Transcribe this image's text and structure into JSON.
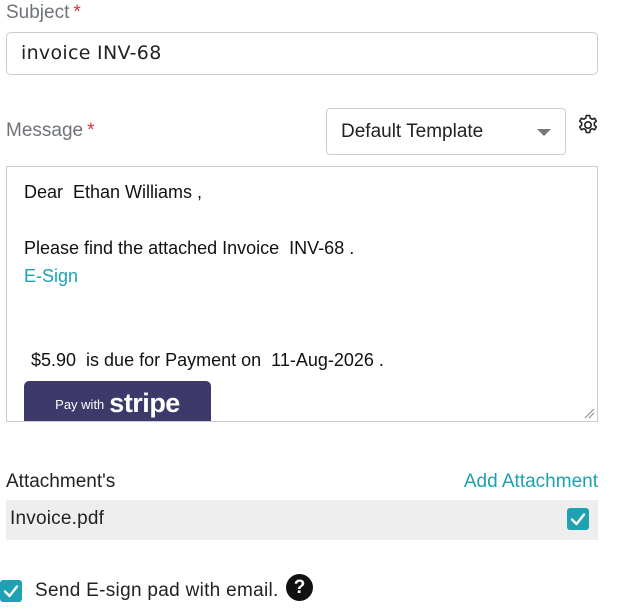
{
  "form": {
    "subject_label": "Subject",
    "required_mark": "*",
    "subject_value": "invoice INV-68",
    "message_label": "Message",
    "template_selected": "Default Template"
  },
  "editor": {
    "line1": "Dear  Ethan Williams ,",
    "line2": "Please find the attached Invoice  INV-68 .",
    "esign_link": "E-Sign",
    "line3": " $5.90  is due for Payment on  11-Aug-2026 .",
    "stripe_small": "Pay with",
    "stripe_big": "stripe"
  },
  "attachments": {
    "label": "Attachment's",
    "add_label": "Add Attachment",
    "items": [
      {
        "name": "Invoice.pdf",
        "checked": true
      }
    ]
  },
  "esign_pad": {
    "label": "Send E-sign pad with email.",
    "checked": true,
    "help_glyph": "?"
  },
  "icons": {
    "settings": "gear-icon",
    "dropdown": "chevron-down-icon",
    "help": "question-circle-icon",
    "check": "checkmark-icon"
  },
  "colors": {
    "accent": "#1ea1b0",
    "required": "#d9363e",
    "stripe_button": "#3d3a6b"
  }
}
